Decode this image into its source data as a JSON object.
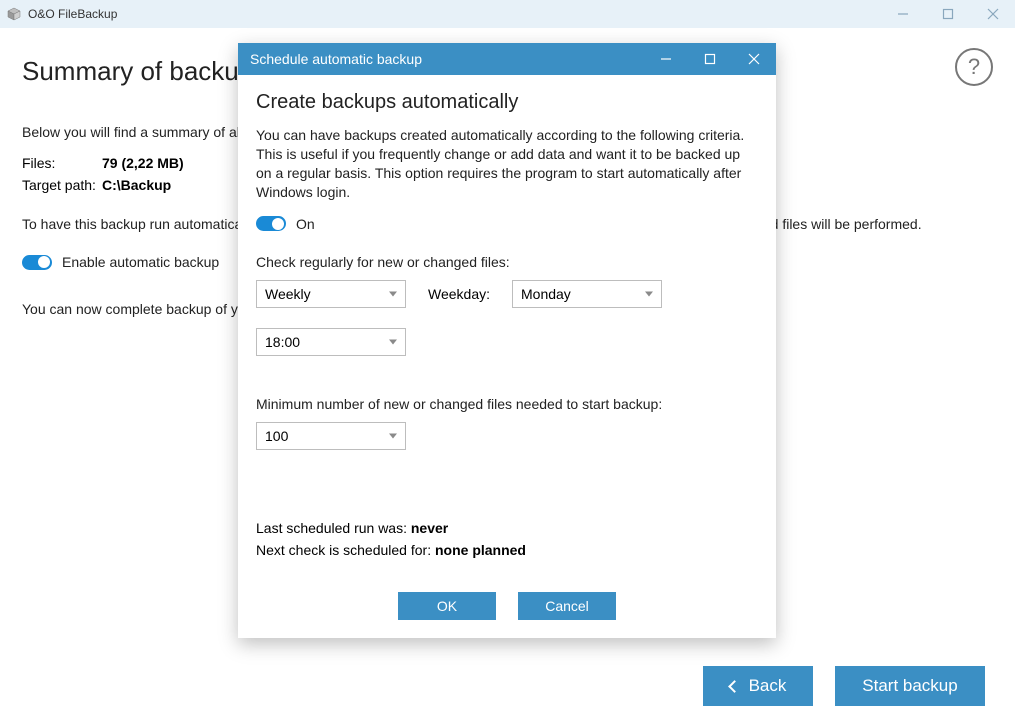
{
  "app": {
    "title": "O&O FileBackup"
  },
  "page": {
    "heading": "Summary of backup",
    "intro": "Below you will find a summary of all of the settings for this backup. Please check these carefully before you proceed.",
    "files_label": "Files:",
    "files_value": "79 (2,22 MB)",
    "target_label": "Target path:",
    "target_value": "C:\\Backup",
    "auto_para": "To have this backup run automatically at a specified time, activate the following option. Only a backup of new and modified files will be performed.",
    "auto_toggle_label": "Enable automatic backup",
    "complete_para": "You can now complete backup of your data.",
    "back_btn": "Back",
    "start_btn": "Start backup"
  },
  "modal": {
    "title": "Schedule automatic backup",
    "heading": "Create backups automatically",
    "desc": "You can have backups created automatically according to the following criteria. This is useful if you frequently change or add data and want it to be backed up on a regular basis. This option requires the program to start automatically after Windows login.",
    "toggle_label": "On",
    "check_label": "Check regularly for new or changed files:",
    "frequency": "Weekly",
    "weekday_label": "Weekday:",
    "weekday_value": "Monday",
    "time_value": "18:00",
    "min_label": "Minimum number of new or changed files needed to start backup:",
    "min_value": "100",
    "last_run_prefix": "Last scheduled run was: ",
    "last_run_value": "never",
    "next_check_prefix": "Next check is scheduled for: ",
    "next_check_value": "none planned",
    "ok_btn": "OK",
    "cancel_btn": "Cancel"
  }
}
